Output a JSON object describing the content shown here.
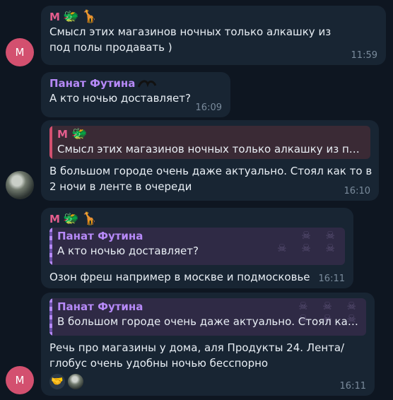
{
  "messages": [
    {
      "sender": "М",
      "sender_emoji": [
        "🐲",
        "🦒"
      ],
      "text": "Смысл этих магазинов ночных только алкашку из под полы продавать )",
      "time": "11:59",
      "avatar_letter": "М"
    },
    {
      "sender": "Панат Футина",
      "text": "А кто ночью доставляет?",
      "time": "16:09"
    },
    {
      "reply_to": {
        "sender": "М",
        "sender_emoji": [
          "🐲"
        ],
        "text": "Смысл этих магазинов ночных только алкашку из под..."
      },
      "text": "В большом городе очень даже актуально. Стоял как то в 2 ночи в ленте в очереди",
      "time": "16:10"
    },
    {
      "sender": "М",
      "sender_emoji": [
        "🐲",
        "🦒"
      ],
      "reply_to": {
        "sender": "Панат Футина",
        "text": "А кто ночью доставляет?"
      },
      "text": "Озон фреш например в москве и подмосковье",
      "time": "16:11"
    },
    {
      "reply_to": {
        "sender": "Панат Футина",
        "text": "В большом городе очень даже актуально. Стоял как т..."
      },
      "text": "Речь про магазины у дома, аля Продукты 24. Лента/глобус очень удобны ночью бесспорно",
      "reaction_emoji": "🤝",
      "time": "16:11",
      "avatar_letter": "М"
    }
  ],
  "colors": {
    "background": "#0e1621",
    "bubble": "#182533",
    "accent_pink": "#e45d8d",
    "accent_violet": "#b689f7"
  }
}
